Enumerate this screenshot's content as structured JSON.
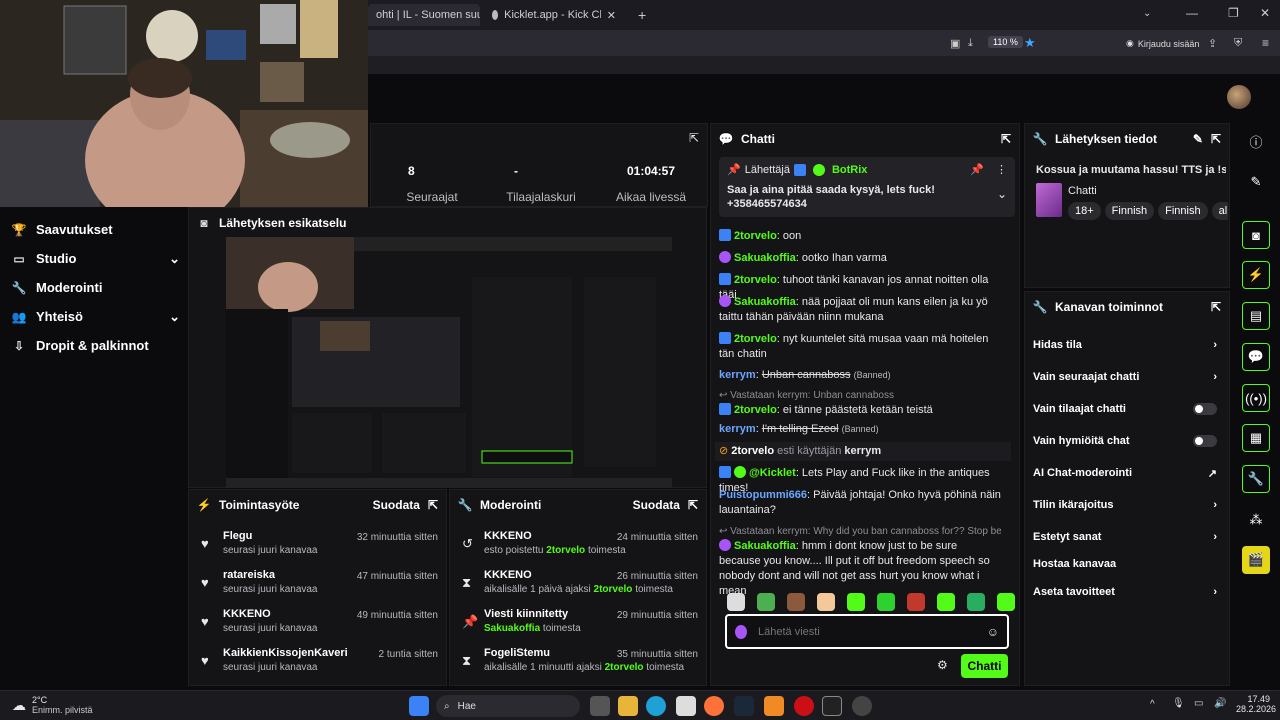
{
  "browser": {
    "tabs": [
      {
        "label": "ohti | IL - Suomen suurin uu"
      },
      {
        "label": "Kicklet.app - Kick Chatbot and C"
      }
    ],
    "zoom": "110 %",
    "signin": "Kirjaudu sisään"
  },
  "nav": {
    "items": [
      {
        "label": "Saavutukset"
      },
      {
        "label": "Studio"
      },
      {
        "label": "Moderointi"
      },
      {
        "label": "Yhteisö"
      },
      {
        "label": "Dropit & palkinnot"
      }
    ]
  },
  "stats": {
    "followers_value": "8",
    "followers_label": "Seuraajat",
    "subs_value": "-",
    "subs_label": "Tilaajalaskuri",
    "live_value": "01:04:57",
    "live_label": "Aikaa livessä"
  },
  "preview": {
    "title": "Lähetyksen esikatselu"
  },
  "activity": {
    "title": "Toimintasyöte",
    "filter": "Suodata",
    "items": [
      {
        "name": "Flegu",
        "desc": "seurasi juuri kanavaa",
        "time": "32 minuuttia sitten"
      },
      {
        "name": "ratareiska",
        "desc": "seurasi juuri kanavaa",
        "time": "47 minuuttia sitten"
      },
      {
        "name": "KKKENO",
        "desc": "seurasi juuri kanavaa",
        "time": "49 minuuttia sitten"
      },
      {
        "name": "KaikkienKissojenKaveri",
        "desc": "seurasi juuri kanavaa",
        "time": "2 tuntia sitten"
      }
    ]
  },
  "moderation": {
    "title": "Moderointi",
    "filter": "Suodata",
    "items": [
      {
        "name": "KKKENO",
        "desc_a": "esto poistettu ",
        "target": "2torvelo",
        "desc_b": " toimesta",
        "time": "24 minuuttia sitten"
      },
      {
        "name": "KKKENO",
        "desc_a": "aikalisälle 1 päivä ajaksi ",
        "target": "2torvelo",
        "desc_b": " toimesta",
        "time": "26 minuuttia sitten"
      },
      {
        "name": "Viesti kiinnitetty",
        "desc_a": "",
        "target": "Sakuakoffia",
        "desc_b": " toimesta",
        "time": "29 minuuttia sitten"
      },
      {
        "name": "FogeliStemu",
        "desc_a": "aikalisälle 1 minuutti ajaksi ",
        "target": "2torvelo",
        "desc_b": " toimesta",
        "time": "35 minuuttia sitten"
      }
    ]
  },
  "chat": {
    "title": "Chatti",
    "pinned": {
      "by_label": "Lähettäjä",
      "by_user": "BotRix",
      "text": "Saa ja aina pitää saada kysyä, lets fuck! +358465574634"
    },
    "messages": [
      {
        "user": "2torvelo",
        "text": ": oon"
      },
      {
        "user": "Sakuakoffia",
        "text": ": ootko Ihan varma"
      },
      {
        "user": "2torvelo",
        "text": ": tuhoot tänki kanavan jos annat noitten olla tääi"
      },
      {
        "user": "Sakuakoffia",
        "text": ": nää pojjaat oli mun kans eilen ja ku yö taittu tähän päivään niinn mukana"
      },
      {
        "user": "2torvelo",
        "text": ": nyt kuuntelet sitä musaa vaan mä hoitelen tän chatin"
      },
      {
        "user": "kerrym",
        "text": "Unban cannaboss",
        "tag": "(Banned)"
      },
      {
        "reply": "Vastataan kerrym: Unban cannaboss",
        "user": "2torvelo",
        "text": ": ei tänne päästetä ketään teistä"
      },
      {
        "user": "kerrym",
        "text": "I'm telling Ezeol",
        "tag": "(Banned)"
      },
      {
        "system_a": "2torvelo",
        "system_b": " esti käyttäjän ",
        "system_c": "kerrym"
      },
      {
        "user": "@Kicklet",
        "text": ": Lets Play and Fuck like in the antiques times!"
      },
      {
        "user": "Puistopummi666",
        "text": ": Päivää johtaja! Onko hyvä pöhinä näin lauantaina?"
      },
      {
        "reply": "Vastataan kerrym: Why did you ban cannaboss for?? Stop bein...",
        "user": "Sakuakoffia",
        "text": ": hmm i dont know just to be sure because you know.... Ill put it off but freedom speech so nobody dont and will not get ass hurt you know what i mean"
      }
    ],
    "input_placeholder": "Lähetä viesti",
    "send_label": "Chatti"
  },
  "stream_info": {
    "title": "Lähetyksen tiedot",
    "stream_title": "Kossua ja muutama hassu! TTS ja !sr",
    "category": "Chatti",
    "tags": [
      "18+",
      "Finnish",
      "Finnish",
      "al"
    ]
  },
  "channel_actions": {
    "title": "Kanavan toiminnot",
    "items": [
      {
        "label": "Hidas tila",
        "control": "chevron"
      },
      {
        "label": "Vain seuraajat chatti",
        "control": "chevron"
      },
      {
        "label": "Vain tilaajat chatti",
        "control": "toggle"
      },
      {
        "label": "Vain hymiöitä chat",
        "control": "toggle"
      },
      {
        "label": "AI Chat-moderointi",
        "control": "external"
      },
      {
        "label": "Tilin ikärajoitus",
        "control": "chevron"
      },
      {
        "label": "Estetyt sanat",
        "control": "chevron"
      },
      {
        "label": "Hostaa kanavaa",
        "control": "none"
      },
      {
        "label": "Aseta tavoitteet",
        "control": "chevron"
      }
    ]
  },
  "taskbar": {
    "weather_temp": "2°C",
    "weather_desc": "Enimm. pilvistä",
    "search": "Hae",
    "time": "17.49",
    "date": "28.2.2026"
  },
  "colors": {
    "accent": "#53fc18",
    "panel": "#141416",
    "bg": "#0b0b0d"
  }
}
